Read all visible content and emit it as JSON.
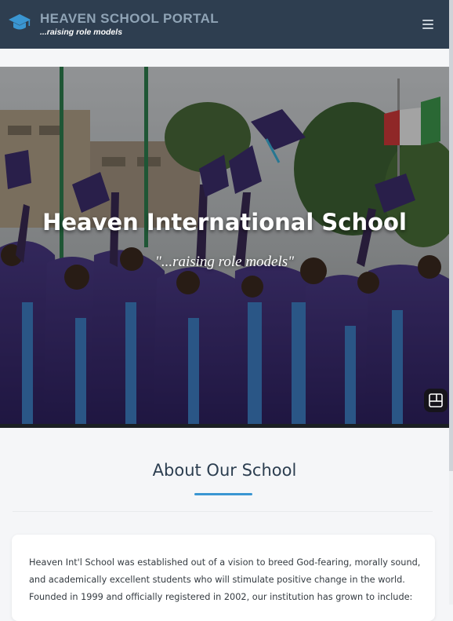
{
  "header": {
    "brand_title": "HEAVEN SCHOOL PORTAL",
    "brand_tagline": "...raising role models",
    "brand_icon": "graduation-cap-icon",
    "menu_icon": "hamburger-menu-icon",
    "background": "#2e3e50",
    "brand_color": "#8fa3b5",
    "icon_color": "#3a96d2"
  },
  "hero": {
    "title": "Heaven International School",
    "subtitle": "\"...raising role models\"",
    "gallery_icon": "gallery-view-icon"
  },
  "about": {
    "title": "About Our School",
    "accent": "#3a96d2",
    "text": "Heaven Int'l School was established out of a vision to breed God-fearing, morally sound, and academically excellent students who will stimulate positive change in the world. Founded in 1999 and officially registered in 2002, our institution has grown to include:"
  }
}
